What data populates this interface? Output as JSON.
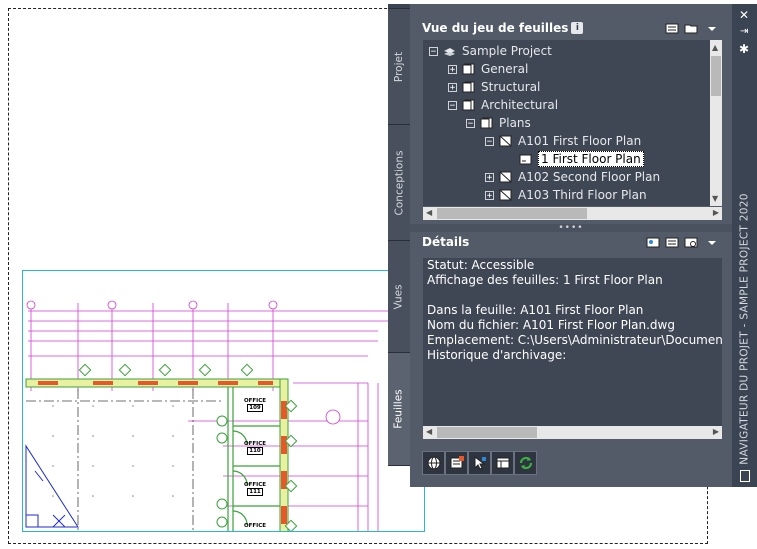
{
  "palette": {
    "title": "NAVIGATEUR DU PROJET - SAMPLE PROJECT 2020",
    "tabs": [
      "Projet",
      "Conceptions",
      "Vues",
      "Feuilles"
    ],
    "active_tab": "Feuilles"
  },
  "sheet_set": {
    "header": "Vue du jeu de feuilles",
    "tree": [
      {
        "label": "Sample Project",
        "expander": "−"
      },
      {
        "label": "General",
        "expander": "+"
      },
      {
        "label": "Structural",
        "expander": "+"
      },
      {
        "label": "Architectural",
        "expander": "−"
      },
      {
        "label": "Plans",
        "expander": "−"
      },
      {
        "label": "A101 First Floor Plan",
        "expander": "−"
      },
      {
        "label": "1 First Floor Plan",
        "expander": ""
      },
      {
        "label": "A102 Second Floor Plan",
        "expander": "+"
      },
      {
        "label": "A103 Third Floor Plan",
        "expander": "+"
      }
    ]
  },
  "details": {
    "header": "Détails",
    "lines": [
      "Statut: Accessible",
      "Affichage des feuilles: 1 First Floor Plan",
      "",
      "Dans la feuille: A101 First Floor Plan",
      "Nom du fichier: A101 First Floor Plan.dwg",
      "Emplacement: C:\\Users\\Administrateur\\Documents\\Aut",
      "Historique d'archivage:"
    ]
  },
  "drawing": {
    "room_labels": [
      "OFFICE",
      "OFFICE",
      "OFFICE",
      "OFFICE"
    ],
    "room_numbers": [
      "109",
      "110",
      "111",
      ""
    ]
  },
  "colors": {
    "panel": "#535b68",
    "tree_bg": "#3f4755",
    "magenta": "#d23cd2",
    "viewport_border": "#2bb7c9"
  }
}
